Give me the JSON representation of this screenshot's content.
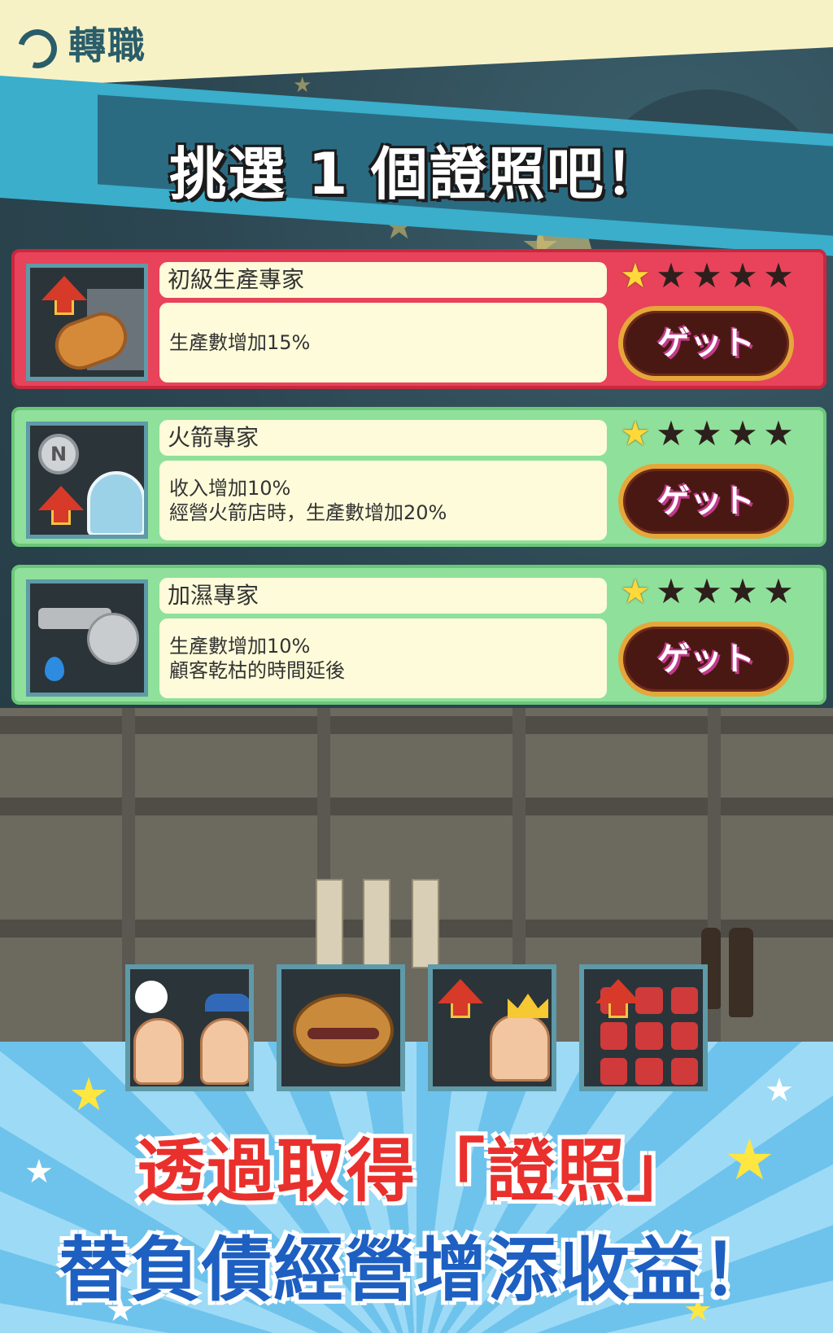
{
  "header": {
    "title": "轉職",
    "icon": "job-change-icon"
  },
  "banner": {
    "title": "挑選 1 個證照吧！"
  },
  "licenses": [
    {
      "name": "初級生產專家",
      "description": [
        "生產數增加15%"
      ],
      "rating": 1,
      "max_rating": 5,
      "button_label": "ゲット",
      "selected": true,
      "icon": "bread-upgrade-icon"
    },
    {
      "name": "火箭專家",
      "description": [
        "收入增加10%",
        "經營火箭店時，生產數增加20%"
      ],
      "rating": 1,
      "max_rating": 5,
      "button_label": "ゲット",
      "selected": false,
      "icon": "coin-astronaut-icon"
    },
    {
      "name": "加濕專家",
      "description": [
        "生產數增加10%",
        "顧客乾枯的時間延後"
      ],
      "rating": 1,
      "max_rating": 5,
      "button_label": "ゲット",
      "selected": false,
      "icon": "faucet-icon"
    }
  ],
  "owned_licenses": [
    {
      "icon": "staff-characters-icon"
    },
    {
      "icon": "dorayaki-icon"
    },
    {
      "icon": "king-upgrade-icon"
    },
    {
      "icon": "grid-upgrade-icon"
    }
  ],
  "caption": {
    "line1": "透過取得「證照」",
    "line2": "替負債經營增添收益！"
  },
  "colors": {
    "selected_card": "#e8435a",
    "normal_card": "#8fe09b",
    "banner": "#3aaecb",
    "caption_red": "#e9302c",
    "caption_blue": "#1e5fc2"
  }
}
